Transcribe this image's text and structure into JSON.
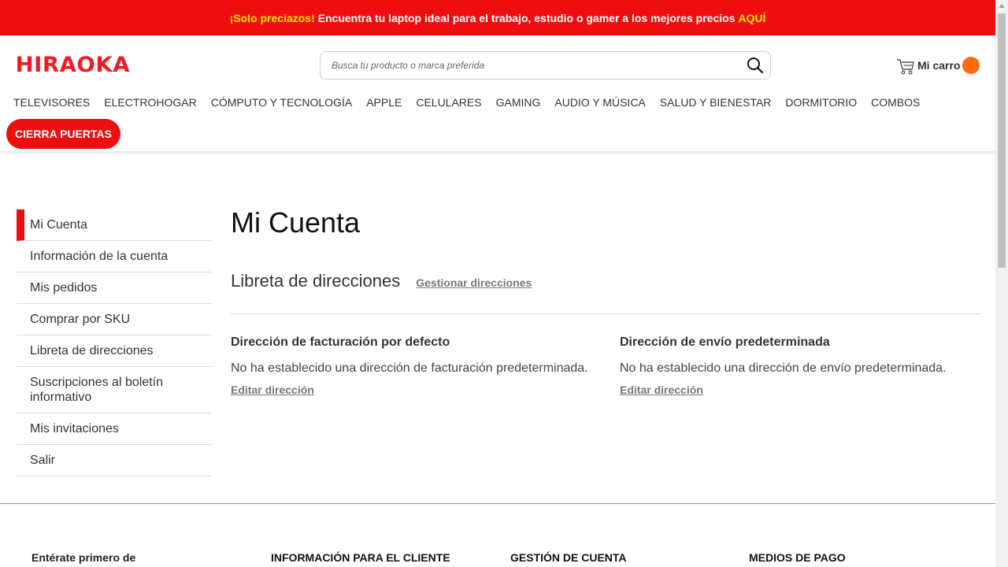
{
  "promo_bar": {
    "lead": "¡Solo preciazos!",
    "text": " Encuentra tu laptop ideal para el trabajo, estudio o gamer a los mejores precios ",
    "link": "AQUÍ"
  },
  "header": {
    "logo": "HIRAOKA",
    "search_placeholder": "Busca tu producto o marca preferida",
    "cart_label": "Mi carro",
    "colors": {
      "brand": "#ee0e10",
      "cart_badge": "#ff6a13"
    }
  },
  "nav": {
    "items": [
      "TELEVISORES",
      "ELECTROHOGAR",
      "CÓMPUTO Y TECNOLOGÍA",
      "APPLE",
      "CELULARES",
      "GAMING",
      "AUDIO Y MÚSICA",
      "SALUD Y BIENESTAR",
      "DORMITORIO",
      "COMBOS"
    ],
    "promo_button": "CIERRA PUERTAS"
  },
  "sidebar": {
    "items": [
      "Mi Cuenta",
      "Información de la cuenta",
      "Mis pedidos",
      "Comprar por SKU",
      "Libreta de direcciones",
      "Suscripciones al boletín informativo",
      "Mis invitaciones",
      "Salir"
    ],
    "active_index": 0
  },
  "main": {
    "title": "Mi Cuenta",
    "address_book": {
      "title": "Libreta de direcciones",
      "manage_link": "Gestionar direcciones",
      "billing": {
        "heading": "Dirección de facturación por defecto",
        "text": "No ha establecido una dirección de facturación predeterminada.",
        "edit_link": "Editar dirección"
      },
      "shipping": {
        "heading": "Dirección de envío predeterminada",
        "text": "No ha establecido una dirección de envío predeterminada.",
        "edit_link": "Editar dirección"
      }
    }
  },
  "footer": {
    "newsletter": "Entérate primero de",
    "columns": [
      "INFORMACIÓN PARA EL CLIENTE",
      "GESTIÓN DE CUENTA",
      "MEDIOS DE PAGO"
    ]
  }
}
